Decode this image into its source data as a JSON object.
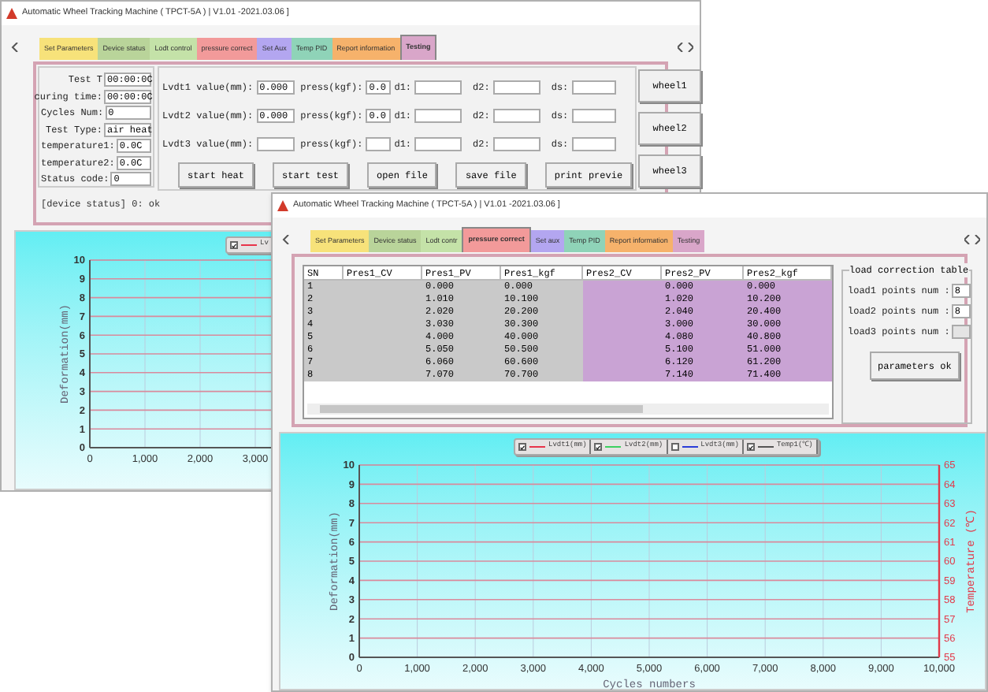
{
  "back_window": {
    "title": "Automatic Wheel Tracking Machine ( TPCT-5A ) | V1.01 -2021.03.06 ]",
    "tabs": [
      {
        "label": "Set Parameters",
        "color": "#f7e27a",
        "selected": false
      },
      {
        "label": "Device status",
        "color": "#b9d49a",
        "selected": false
      },
      {
        "label": "Lodt control",
        "color": "#c4e2a8",
        "selected": false
      },
      {
        "label": "pressure correct",
        "color": "#f29a9a",
        "selected": false
      },
      {
        "label": "Set Aux",
        "color": "#b3a6f0",
        "selected": false
      },
      {
        "label": "Temp PID",
        "color": "#8fd3b8",
        "selected": false
      },
      {
        "label": "Report information",
        "color": "#f6b26b",
        "selected": false
      },
      {
        "label": "Testing",
        "color": "#d9a6c9",
        "selected": true
      }
    ],
    "fields": [
      {
        "label": "Test T",
        "value": "00:00:0C"
      },
      {
        "label": "curing time:",
        "value": "00:00:0C"
      },
      {
        "label": "Cycles Num:",
        "value": "0"
      },
      {
        "label": "Test Type:",
        "value": "air heat"
      },
      {
        "label": "temperature1:",
        "value": "0.0C"
      },
      {
        "label": "temperature2:",
        "value": "0.0C"
      },
      {
        "label": "Status code:",
        "value": "0"
      }
    ],
    "lvdt_rows": [
      {
        "label": "Lvdt1 value(mm):",
        "value": "0.000",
        "press_label": "press(kgf):",
        "press_value": "0.0",
        "d1_label": "d1:",
        "d2_label": "d2:",
        "ds_label": "ds:"
      },
      {
        "label": "Lvdt2 value(mm):",
        "value": "0.000",
        "press_label": "press(kgf):",
        "press_value": "0.0",
        "d1_label": "d1:",
        "d2_label": "d2:",
        "ds_label": "ds:"
      },
      {
        "label": "Lvdt3 value(mm):",
        "press_label": "press(kgf):",
        "d1_label": "d1:",
        "d2_label": "d2:",
        "ds_label": "ds:"
      }
    ],
    "buttons": [
      "start heat",
      "start test",
      "open file",
      "save file",
      "print previe"
    ],
    "wheel_buttons": [
      "wheel1",
      "wheel2",
      "wheel3"
    ],
    "device_status": "[device status] 0: ok",
    "chart": {
      "legend": [
        {
          "label": "Lv",
          "color": "#e8344a",
          "checked": true
        }
      ],
      "chart_data": {
        "type": "line",
        "ylabel": "Deformation(mm)",
        "grid": true,
        "xlim": [
          0,
          10000
        ],
        "ylim": [
          0,
          10
        ],
        "xticks": [
          {
            "value": 0,
            "label": "0"
          },
          {
            "value": 1000,
            "label": "1,000"
          },
          {
            "value": 2000,
            "label": "2,000"
          },
          {
            "value": 3000,
            "label": "3,000"
          }
        ],
        "yticks": [
          0,
          1,
          2,
          3,
          4,
          5,
          6,
          7,
          8,
          9,
          10
        ]
      }
    }
  },
  "front_window": {
    "title": "Automatic Wheel Tracking Machine ( TPCT-5A ) | V1.01 -2021.03.06 ]",
    "tabs": [
      {
        "label": "Set Parameters",
        "color": "#f7e27a",
        "selected": false
      },
      {
        "label": "Device status",
        "color": "#b9d49a",
        "selected": false
      },
      {
        "label": "Lodt contr",
        "color": "#c4e2a8",
        "selected": false
      },
      {
        "label": "pressure correct",
        "color": "#f29a9a",
        "selected": true
      },
      {
        "label": "Set aux",
        "color": "#b3a6f0",
        "selected": false
      },
      {
        "label": "Temp PID",
        "color": "#8fd3b8",
        "selected": false
      },
      {
        "label": "Report information",
        "color": "#f6b26b",
        "selected": false
      },
      {
        "label": "Testing",
        "color": "#d9a6c9",
        "selected": false
      }
    ],
    "table": {
      "columns": [
        {
          "label": "SN",
          "color": "#c9c9c9"
        },
        {
          "label": "Pres1_CV",
          "color": "#c9c9c9"
        },
        {
          "label": "Pres1_PV",
          "color": "#c9c9c9"
        },
        {
          "label": "Pres1_kgf",
          "color": "#c9c9c9"
        },
        {
          "label": "Pres2_CV",
          "color": "#c9a3d4"
        },
        {
          "label": "Pres2_PV",
          "color": "#c9a3d4"
        },
        {
          "label": "Pres2_kgf",
          "color": "#c9a3d4"
        }
      ],
      "rows": [
        [
          "1",
          "",
          "0.000",
          "0.000",
          "",
          "0.000",
          "0.000"
        ],
        [
          "2",
          "",
          "1.010",
          "10.100",
          "",
          "1.020",
          "10.200"
        ],
        [
          "3",
          "",
          "2.020",
          "20.200",
          "",
          "2.040",
          "20.400"
        ],
        [
          "4",
          "",
          "3.030",
          "30.300",
          "",
          "3.000",
          "30.000"
        ],
        [
          "5",
          "",
          "4.000",
          "40.000",
          "",
          "4.080",
          "40.800"
        ],
        [
          "6",
          "",
          "5.050",
          "50.500",
          "",
          "5.100",
          "51.000"
        ],
        [
          "7",
          "",
          "6.060",
          "60.600",
          "",
          "6.120",
          "61.200"
        ],
        [
          "8",
          "",
          "7.070",
          "70.700",
          "",
          "7.140",
          "71.400"
        ]
      ]
    },
    "load_table": {
      "title": "load correction table",
      "rows": [
        {
          "label": "load1 points num :",
          "value": "8",
          "disabled": false
        },
        {
          "label": "load2 points num :",
          "value": "8",
          "disabled": false
        },
        {
          "label": "load3 points num :",
          "disabled": true
        }
      ],
      "button": "parameters ok"
    },
    "chart": {
      "legend": [
        {
          "label": "Lvdt1(mm)",
          "color": "#e8344a",
          "checked": true
        },
        {
          "label": "Lvdt2(mm)",
          "color": "#3cd060",
          "checked": true
        },
        {
          "label": "Lvdt3(mm)",
          "color": "#2a3cd8",
          "checked": false
        },
        {
          "label": "Temp1(℃)",
          "color": "#555555",
          "checked": true
        }
      ],
      "chart_data": {
        "type": "line",
        "xlabel": "Cycles numbers",
        "ylabel": "Deformation(mm)",
        "grid": true,
        "xlim": [
          0,
          10000
        ],
        "ylim": [
          0,
          10
        ],
        "xticks": [
          {
            "value": 0,
            "label": "0"
          },
          {
            "value": 1000,
            "label": "1,000"
          },
          {
            "value": 2000,
            "label": "2,000"
          },
          {
            "value": 3000,
            "label": "3,000"
          },
          {
            "value": 4000,
            "label": "4,000"
          },
          {
            "value": 5000,
            "label": "5,000"
          },
          {
            "value": 6000,
            "label": "6,000"
          },
          {
            "value": 7000,
            "label": "7,000"
          },
          {
            "value": 8000,
            "label": "8,000"
          },
          {
            "value": 9000,
            "label": "9,000"
          },
          {
            "value": 10000,
            "label": "10,000"
          }
        ],
        "yticks": [
          0,
          1,
          2,
          3,
          4,
          5,
          6,
          7,
          8,
          9,
          10
        ]
      },
      "right_axis": {
        "label": "Temperature (℃)",
        "ticks": [
          "65",
          "64",
          "63",
          "62",
          "61",
          "60",
          "59",
          "58",
          "57",
          "56",
          "55"
        ]
      }
    }
  }
}
